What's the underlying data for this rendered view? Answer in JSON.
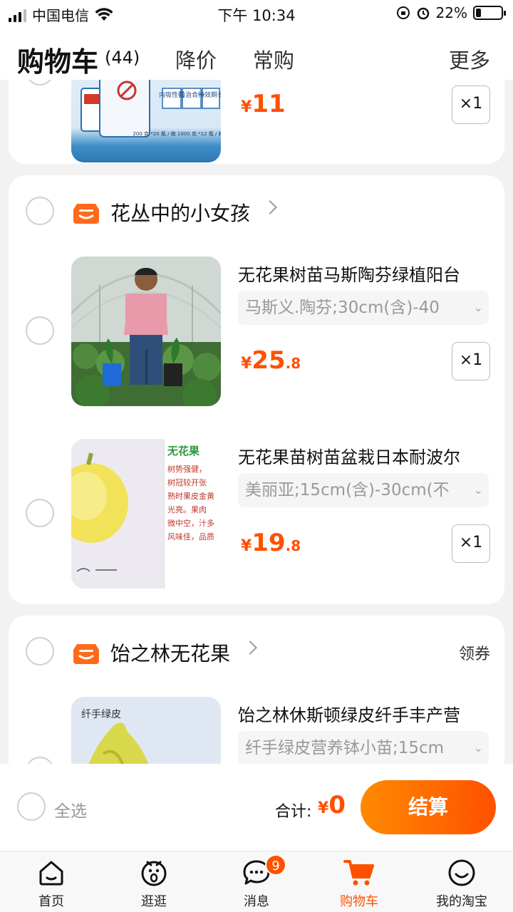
{
  "status_bar": {
    "carrier": "中国电信",
    "time": "下午 10:34",
    "battery": "22%"
  },
  "header": {
    "title": "购物车",
    "count": "(44)",
    "tabs": [
      "降价",
      "常购"
    ],
    "more": "更多"
  },
  "top_item": {
    "package_badges": [
      "内吸性强",
      "防治合一",
      "持效期长"
    ],
    "package_spec": "200 克 *20 瓶 / 箱  1000 克 *12 瓶 / 箱",
    "price_yen": "¥",
    "price_int": "11",
    "qty": "×1"
  },
  "shop1": {
    "name": "花丛中的小女孩",
    "items": [
      {
        "title": "无花果树苗马斯陶芬绿植阳台",
        "sku": "马斯义.陶芬;30cm(含)-40",
        "price_yen": "¥",
        "price_int": "25",
        "price_dec": ".8",
        "qty": "×1"
      },
      {
        "title": "无花果苗树苗盆栽日本耐波尔",
        "sku": "美丽亚;15cm(含)-30cm(不",
        "price_yen": "¥",
        "price_int": "19",
        "price_dec": ".8",
        "qty": "×1",
        "image_text": {
          "heading": "无花果",
          "lines": [
            "树势强健，",
            "树冠较开张",
            "熟时果皮金黄",
            "光亮。果肉",
            "微中空，汁多",
            "风味佳，品质"
          ]
        }
      }
    ]
  },
  "shop2": {
    "name": "饴之林无花果",
    "coupon": "领券",
    "items": [
      {
        "title": "饴之林休斯顿绿皮纤手丰产营",
        "sku": "纤手绿皮营养钵小苗;15cm",
        "image_text": "纤手绿皮"
      }
    ]
  },
  "checkout": {
    "select_all": "全选",
    "total_label": "合计:",
    "total_yen": "¥",
    "total_int": "0",
    "button": "结算"
  },
  "tabbar": [
    {
      "label": "首页",
      "icon": "home-icon"
    },
    {
      "label": "逛逛",
      "icon": "stroll-icon"
    },
    {
      "label": "消息",
      "icon": "message-icon",
      "badge": "9"
    },
    {
      "label": "购物车",
      "icon": "cart-icon",
      "active": true
    },
    {
      "label": "我的淘宝",
      "icon": "profile-icon"
    }
  ],
  "colors": {
    "accent": "#ff5000",
    "accent_gradient_start": "#ff8a00"
  }
}
